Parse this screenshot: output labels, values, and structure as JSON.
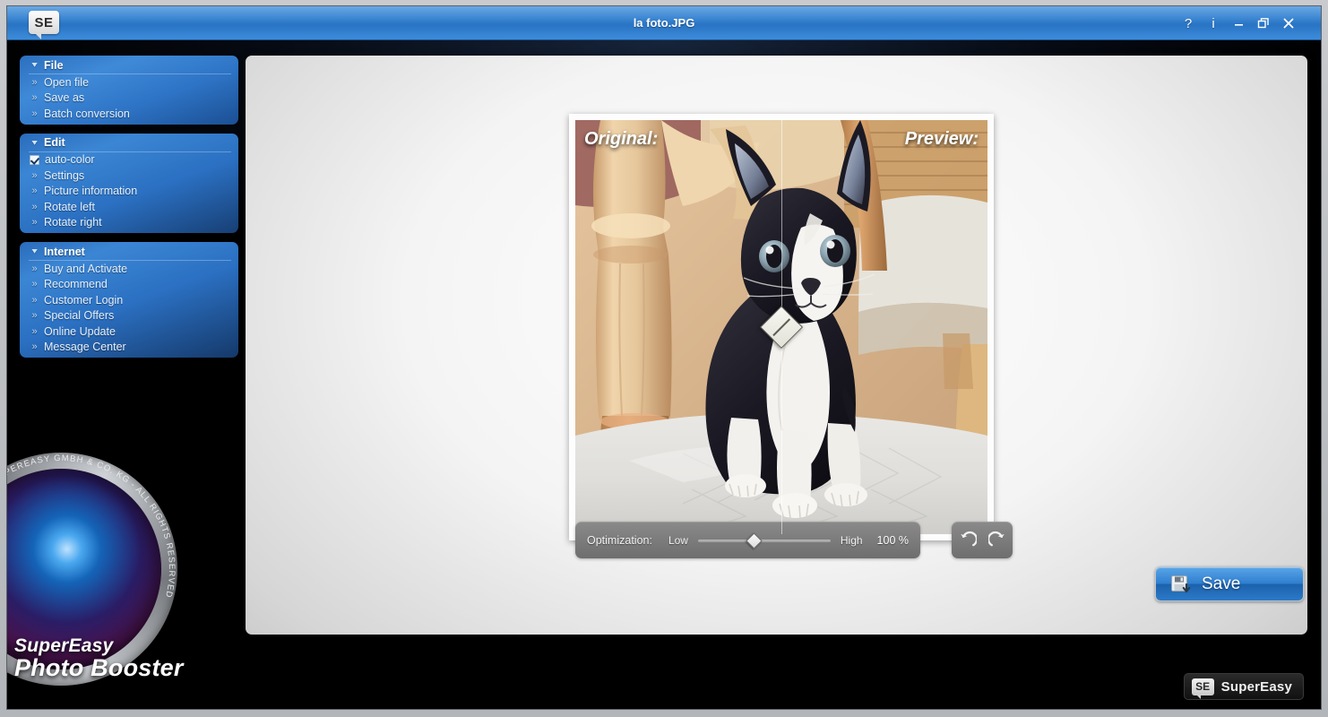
{
  "window": {
    "title": "la foto.JPG",
    "logo_text": "SE",
    "controls": [
      {
        "name": "help",
        "glyph": "?"
      },
      {
        "name": "info",
        "glyph": "i"
      },
      {
        "name": "minimize",
        "glyph": "–"
      },
      {
        "name": "restore",
        "glyph": "❐"
      },
      {
        "name": "close",
        "glyph": "✕"
      }
    ]
  },
  "sidebar": {
    "groups": [
      {
        "title": "File",
        "items": [
          {
            "label": "Open file",
            "type": "link"
          },
          {
            "label": "Save as",
            "type": "link"
          },
          {
            "label": "Batch conversion",
            "type": "link"
          }
        ]
      },
      {
        "title": "Edit",
        "items": [
          {
            "label": "auto-color",
            "type": "checkbox",
            "checked": true
          },
          {
            "label": "Settings",
            "type": "link"
          },
          {
            "label": "Picture information",
            "type": "link"
          },
          {
            "label": "Rotate left",
            "type": "link"
          },
          {
            "label": "Rotate right",
            "type": "link"
          }
        ]
      },
      {
        "title": "Internet",
        "items": [
          {
            "label": "Buy and Activate",
            "type": "link"
          },
          {
            "label": "Recommend",
            "type": "link"
          },
          {
            "label": "Customer Login",
            "type": "link"
          },
          {
            "label": "Special Offers",
            "type": "link"
          },
          {
            "label": "Online Update",
            "type": "link"
          },
          {
            "label": "Message Center",
            "type": "link"
          }
        ]
      }
    ]
  },
  "brand": {
    "line1": "SuperEasy",
    "line2": "Photo Booster",
    "lens_ring_text": "© SUPEREASY GMBH & CO. KG - ALL RIGHTS RESERVED"
  },
  "footer_badge": {
    "chip": "SE",
    "word": "SuperEasy"
  },
  "viewer": {
    "label_original": "Original:",
    "label_preview": "Preview:",
    "split_position_percent": 50,
    "photo_description": "Black and white tuxedo kitten sitting on a white blanket beside a wooden chair leg"
  },
  "optimization": {
    "label": "Optimization:",
    "low_label": "Low",
    "high_label": "High",
    "value_percent": "100 %",
    "slider_position_percent": 42
  },
  "history": {
    "undo_label": "Undo",
    "redo_label": "Redo"
  },
  "actions": {
    "save_label": "Save"
  },
  "colors": {
    "titlebar_blue": "#2d7ccd",
    "menu_blue": "#2f7fd4",
    "save_blue": "#2f7fd0",
    "panel_white": "#f4f4f4",
    "toolbar_gray": "#7b7b7b"
  }
}
